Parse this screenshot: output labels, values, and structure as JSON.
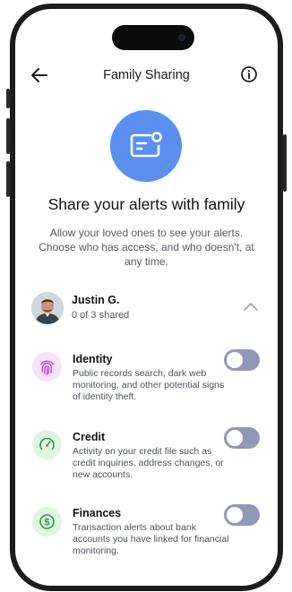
{
  "header": {
    "title": "Family Sharing"
  },
  "hero": {
    "headline": "Share your alerts with family",
    "description": "Allow your loved ones to see your alerts. Choose who has access, and who doesn't, at any time."
  },
  "member": {
    "name": "Justin G.",
    "shared_status": "0 of 3 shared"
  },
  "categories": [
    {
      "title": "Identity",
      "description": "Public records search, dark web monitoring, and other potential signs of identity theft.",
      "icon": "fingerprint-icon",
      "icon_color": "#c04fd3",
      "icon_bg": "#f7e2fb",
      "enabled": false
    },
    {
      "title": "Credit",
      "description": "Activity on your credit file such as credit inquiries, address changes, or new accounts.",
      "icon": "gauge-icon",
      "icon_color": "#2e9a4a",
      "icon_bg": "#ddf6e2",
      "enabled": false
    },
    {
      "title": "Finances",
      "description": "Transaction alerts about bank accounts you have linked for financial monitoring.",
      "icon": "dollar-icon",
      "icon_color": "#2e9a4a",
      "icon_bg": "#ddf6e2",
      "enabled": false
    }
  ],
  "colors": {
    "accent": "#5a8ff0",
    "toggle_off": "#9198b6"
  }
}
